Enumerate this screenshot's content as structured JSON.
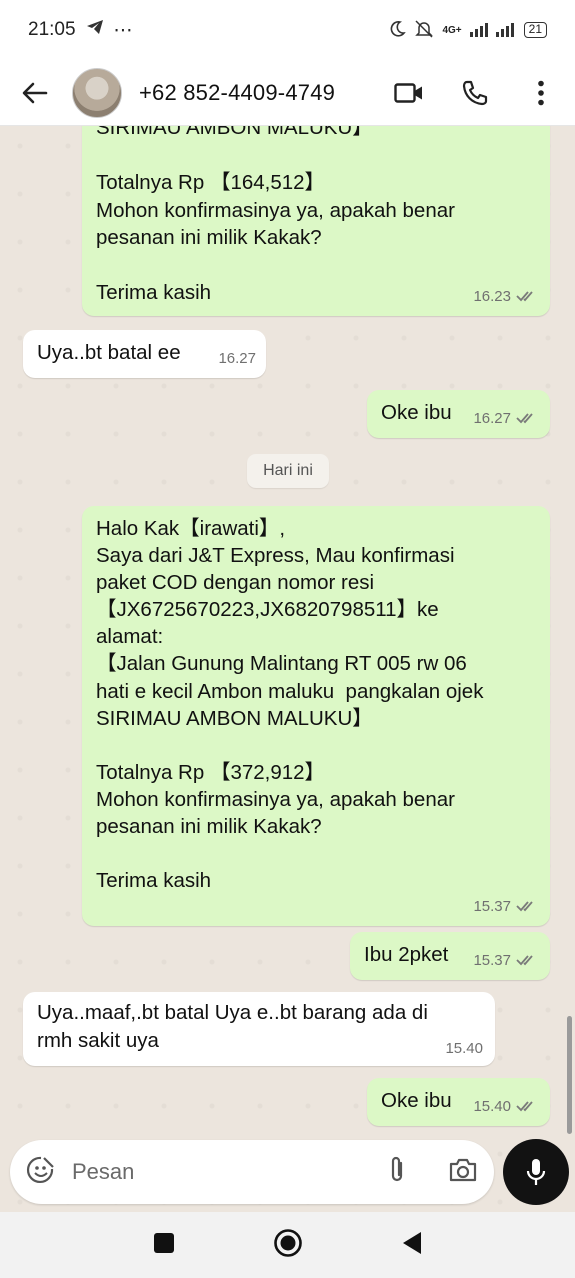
{
  "status_bar": {
    "time": "21:05",
    "extra": "⋯",
    "network": "4G+",
    "battery": "21"
  },
  "header": {
    "contact": "+62 852-4409-4749"
  },
  "day_divider": "Hari ini",
  "messages": [
    {
      "dir": "out",
      "text": "SIRIMAU AMBON MALUKU】\n\nTotalnya Rp 【164,512】\nMohon konfirmasinya ya, apakah benar\npesanan ini milik Kakak?\n\nTerima kasih",
      "time": "16.23"
    },
    {
      "dir": "in",
      "text": "Uya..bt batal ee",
      "time": "16.27"
    },
    {
      "dir": "out",
      "text": "Oke ibu",
      "time": "16.27"
    },
    {
      "dir": "out",
      "text": "Halo Kak【irawati】,\nSaya dari J&T Express, Mau konfirmasi\npaket COD dengan nomor resi\n【JX6725670223,JX6820798511】ke\nalamat:\n【Jalan Gunung Malintang RT 005 rw 06\nhati e kecil Ambon maluku  pangkalan ojek\nSIRIMAU AMBON MALUKU】\n\nTotalnya Rp 【372,912】\nMohon konfirmasinya ya, apakah benar\npesanan ini milik Kakak?\n\nTerima kasih",
      "time": "15.37"
    },
    {
      "dir": "out",
      "text": "Ibu 2pket",
      "time": "15.37"
    },
    {
      "dir": "in",
      "text": "Uya..maaf,.bt batal Uya e..bt barang ada di\nrmh sakit uya",
      "time": "15.40"
    },
    {
      "dir": "out",
      "text": "Oke ibu",
      "time": "15.40"
    }
  ],
  "composer": {
    "placeholder": "Pesan"
  },
  "colors": {
    "outgoing": "#dcf8c6",
    "incoming": "#ffffff",
    "read_ticks": "#7a7a7a"
  },
  "icons": [
    "telegram-icon",
    "moon-icon",
    "mute-bell-icon",
    "signal-icon",
    "back-arrow-icon",
    "video-call-icon",
    "phone-icon",
    "more-vert-icon",
    "emoji-icon",
    "attach-icon",
    "camera-icon",
    "mic-icon",
    "nav-recents-icon",
    "nav-home-icon",
    "nav-back-icon"
  ]
}
